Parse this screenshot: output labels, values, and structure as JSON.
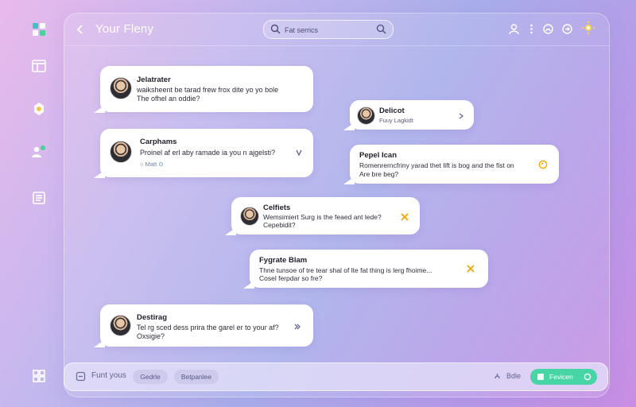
{
  "header": {
    "title": "Your Fleny",
    "search_placeholder": "Fat serrics"
  },
  "sidebar": {
    "icons": [
      "app-logo-icon",
      "dashboard-icon",
      "notification-icon",
      "contacts-icon",
      "document-icon",
      "puzzle-icon"
    ]
  },
  "top_actions": [
    "account-icon",
    "more-icon",
    "globe-icon",
    "share-icon",
    "sun-icon"
  ],
  "messages": [
    {
      "name": "Jelatrater",
      "lines": [
        "waiksheent be tarad frew frox dite yo yo bole",
        "The ofhel an oddie?"
      ],
      "action": "none"
    },
    {
      "name": "Carphams",
      "lines": [
        "Proinel af erl aby ramade ia you n ajgelsti?"
      ],
      "meta": "Matt",
      "action": "chevron"
    },
    {
      "name": "Delicot",
      "lines": [
        "Fuuy Lagkidt"
      ],
      "action": "chevron"
    },
    {
      "name": "Pepel Ican",
      "lines": [
        "Romenrerncfriny yarad thet lift is bog and the fist on",
        "Are bre beg?"
      ],
      "action": "circle"
    },
    {
      "name": "Celfiets",
      "lines": [
        "Wemsimiert Surg is the feaed ant lede?",
        "Cepebidit?"
      ],
      "action": "close"
    },
    {
      "name": "Fygrate Blam",
      "lines": [
        "Thne tunsoe of tre tear shal of lte fat thing is lerg fhoime...",
        "Cosel ferpdar so fre?"
      ],
      "action": "close"
    },
    {
      "name": "Destirag",
      "lines": [
        "Tel rg sced dess prira the garel er to your af?",
        "Oxsigie?"
      ],
      "action": "chevron"
    }
  ],
  "composer": {
    "placeholder": "Funt yous",
    "chips": [
      "Gedrle",
      "Betpanlee"
    ],
    "edit_label": "Bdle",
    "send_label": "Fevicen"
  },
  "colors": {
    "send": "#48d5a5",
    "close_accent": "#f2a600",
    "bubble": "#ffffff"
  }
}
